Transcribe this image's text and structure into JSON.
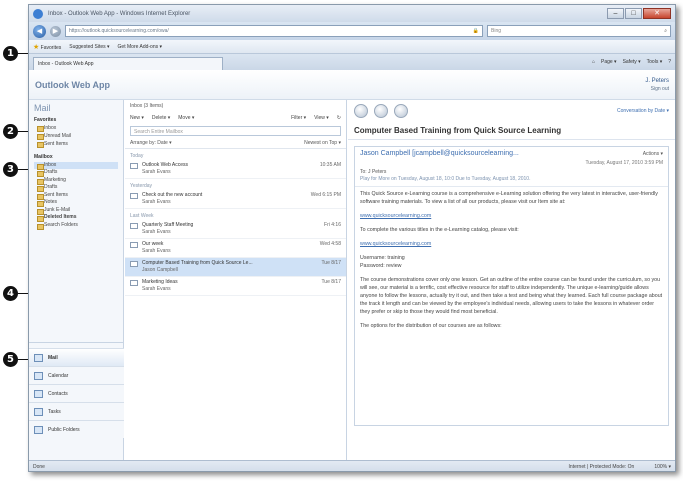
{
  "callouts": [
    "1",
    "2",
    "3",
    "4",
    "5"
  ],
  "browser": {
    "title": "Inbox - Outlook Web App - Windows Internet Explorer",
    "address": "https://outlook.quicksourcelearning.com/owa/",
    "search_placeholder": "Bing",
    "favorites_label": "Favorites",
    "suggested_sites": "Suggested Sites ▾",
    "web_slice": "Get More Add-ons ▾",
    "tab_title": "Inbox - Outlook Web App",
    "cmd_items": [
      "Page ▾",
      "Safety ▾",
      "Tools ▾"
    ],
    "status_left": "Done",
    "status_zone": "Internet | Protected Mode: On",
    "status_zoom": "100% ▾"
  },
  "owa": {
    "logo": "Outlook Web App",
    "user_name": "J. Peters",
    "user_link": "Sign out",
    "left": {
      "header": "Mail",
      "favorites_group": "Favorites",
      "favorites": [
        "Inbox",
        "Unread Mail",
        "Sent Items"
      ],
      "mailbox_group": "Mailbox",
      "folders": [
        "Inbox",
        "Drafts",
        "Marketing",
        "Drafts",
        "Sent Items",
        "Notes",
        "Junk E-Mail",
        "Deleted Items"
      ],
      "search_folders": "Search Folders",
      "nav": [
        "Mail",
        "Calendar",
        "Contacts",
        "Tasks",
        "Public Folders"
      ]
    },
    "middle": {
      "title": "Inbox (3 Items)",
      "toolbar": [
        "New ▾",
        "Delete ▾",
        "Move ▾",
        "Filter ▾",
        "View ▾"
      ],
      "search_placeholder": "Search Entire Mailbox",
      "arrange_by": "Arrange by: Date ▾",
      "arrange_order": "Newest on Top ▾",
      "groups": [
        {
          "label": "Today",
          "messages": [
            {
              "subject": "Outlook Web Access",
              "from": "Sarah Evans",
              "date": "10:35 AM"
            }
          ]
        },
        {
          "label": "Yesterday",
          "messages": [
            {
              "subject": "Check out the new account",
              "from": "Sarah Evans",
              "date": "Wed 6:15 PM"
            }
          ]
        },
        {
          "label": "Last Week",
          "messages": [
            {
              "subject": "Quarterly Staff Meeting",
              "from": "Sarah Evans",
              "date": "Fri 4:16"
            },
            {
              "subject": "Our week",
              "from": "Sarah Evans",
              "date": "Wed 4:58"
            },
            {
              "subject": "Computer Based Training from Quick Source Le...",
              "from": "Jason Campbell",
              "date": "Tue 8/17",
              "selected": true
            },
            {
              "subject": "Marketing Ideas",
              "from": "Sarah Evans",
              "date": "Tue 8/17"
            }
          ]
        }
      ]
    },
    "reading": {
      "top_link": "Conversation by Date ▾",
      "subject": "Computer Based Training from Quick Source Learning",
      "sender": "Jason Campbell [jcampbell@quicksourcelearning...",
      "actions": "Actions ▾",
      "received": "Tuesday, August 17, 2010 3:59 PM",
      "to": "To: J Peters",
      "info": "Play for More on Tuesday, August 18, 10:0 Due to Tuesday, August 18, 2010.",
      "paragraphs": [
        "This Quick Source e-Learning course is a comprehensive e-Learning solution offering the very latest in interactive, user-friendly software training materials. To view a list of all our products, please visit our Item site at:",
        "www.quicksourcelearning.com",
        "To complete the various titles in the e-Learning catalog, please visit:",
        "www.quicksourcelearning.com",
        "Username: training\nPassword: review",
        "The course demonstrations cover only one lesson. Get an outline of the entire course can be found under the curriculum, so you will see, our material is a terrific, cost effective resource for staff to utilize independently. The unique e-learning/guide allows anyone to follow the lessons, actually try it out, and then take a test and being what they learned. Each full course package about the track it length and can be viewed by the employee's individual needs, allowing users to take the lessons in whatever order they prefer or skip to those they would find most beneficial.",
        "The options for the distribution of our courses are as follows:"
      ]
    }
  }
}
